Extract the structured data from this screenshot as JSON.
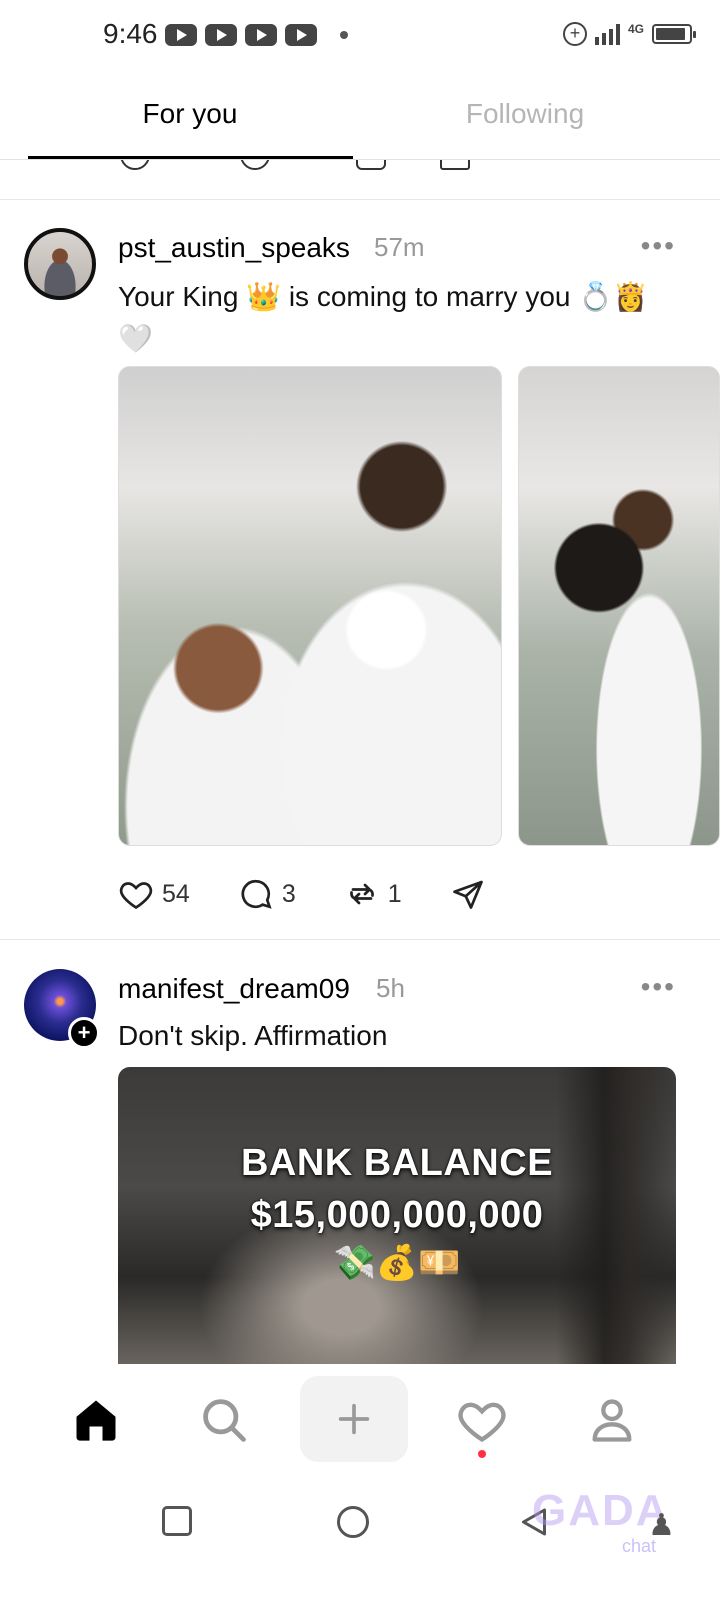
{
  "status_bar": {
    "time": "9:46",
    "network": "4G",
    "notification_icons": [
      "youtube-icon",
      "youtube-icon",
      "youtube-icon",
      "youtube-icon"
    ]
  },
  "tabs": {
    "for_you": "For you",
    "following": "Following",
    "active": "For you"
  },
  "posts": [
    {
      "username": "pst_austin_speaks",
      "time": "57m",
      "caption": "Your King 👑 is coming to marry you 💍👸 🤍",
      "media": [
        "wedding-photo",
        "wedding-photo"
      ],
      "likes": "54",
      "replies": "3",
      "reposts": "1"
    },
    {
      "username": "manifest_dream09",
      "time": "5h",
      "caption": "Don't skip. Affirmation",
      "video_text_line1": "BANK BALANCE",
      "video_text_line2": "$15,000,000,000",
      "video_emojis": "💸💰💴"
    }
  ],
  "bottom_nav": [
    "home-icon",
    "search-icon",
    "create-icon",
    "heart-icon",
    "profile-icon"
  ],
  "watermark": {
    "main": "GADA",
    "sub": "chat"
  },
  "colors": {
    "text": "#000000",
    "muted": "#999999",
    "inactive_tab": "#b5b5b5",
    "notification_dot": "#ff3040"
  }
}
